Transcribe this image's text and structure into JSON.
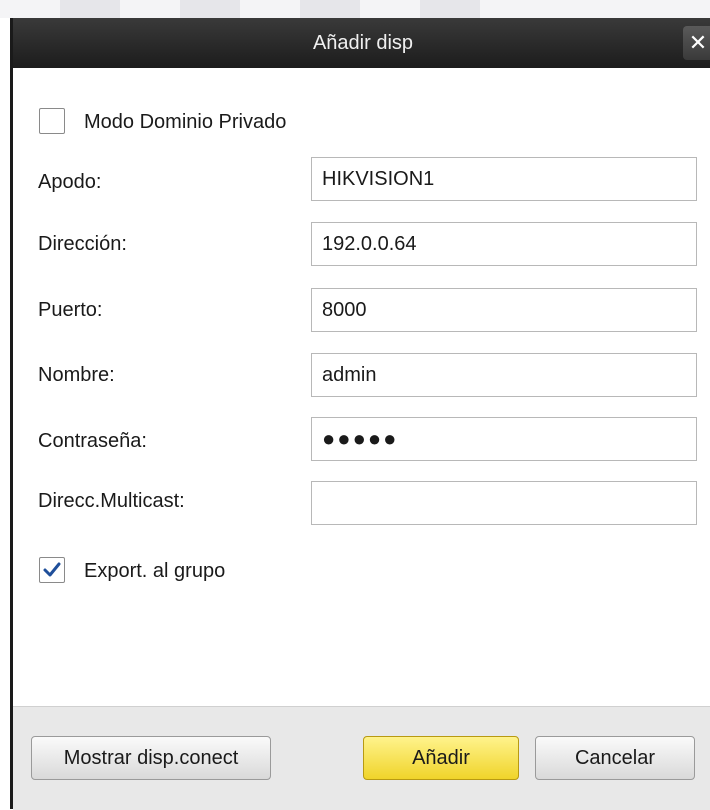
{
  "dialog": {
    "title": "Añadir disp",
    "close_icon": "close-icon"
  },
  "private_domain": {
    "label": "Modo Dominio Privado",
    "checked": false
  },
  "fields": {
    "nickname": {
      "label": "Apodo:",
      "value": "HIKVISION1"
    },
    "address": {
      "label": "Dirección:",
      "value": "192.0.0.64"
    },
    "port": {
      "label": "Puerto:",
      "value": "8000"
    },
    "username": {
      "label": "Nombre:",
      "value": "admin"
    },
    "password": {
      "label": "Contraseña:",
      "value": "●●●●●"
    },
    "multicast": {
      "label": "Direcc.Multicast:",
      "value": ""
    }
  },
  "export_group": {
    "label": "Export. al grupo",
    "checked": true
  },
  "footer": {
    "show_online_label": "Mostrar disp.conect",
    "add_label": "Añadir",
    "cancel_label": "Cancelar"
  },
  "colors": {
    "titlebar": "#1c1c1c",
    "primary_button": "#f0d42a",
    "checkmark": "#1f4f9a"
  }
}
